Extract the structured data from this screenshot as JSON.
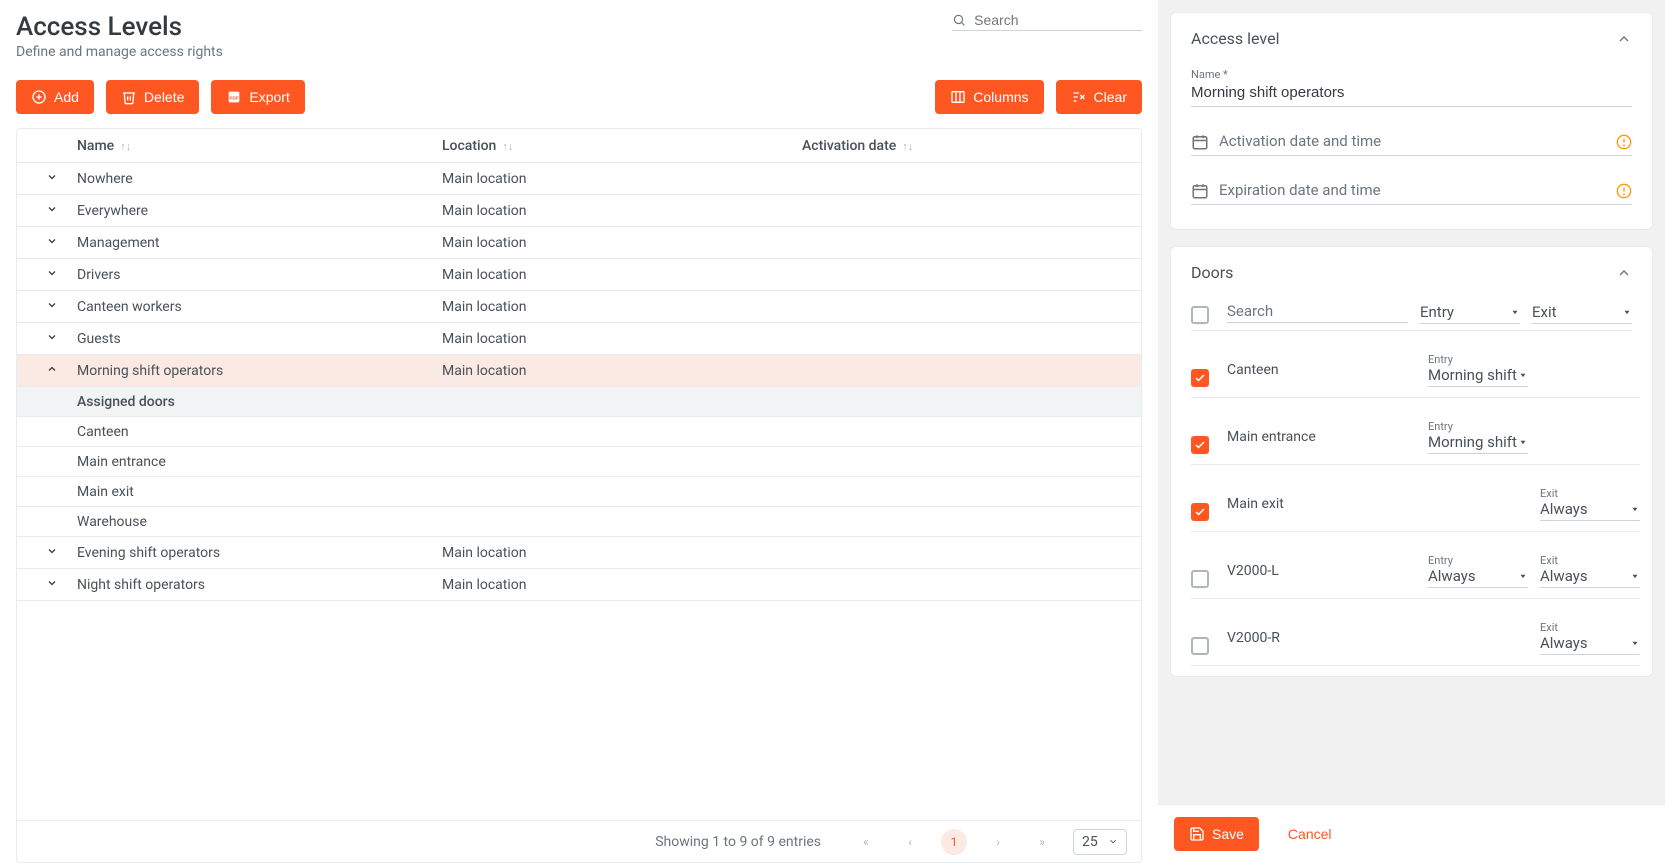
{
  "header": {
    "title": "Access Levels",
    "subtitle": "Define and manage access rights",
    "search_placeholder": "Search"
  },
  "toolbar": {
    "add_label": "Add",
    "delete_label": "Delete",
    "export_label": "Export",
    "columns_label": "Columns",
    "clear_label": "Clear"
  },
  "table": {
    "columns": {
      "name": "Name",
      "location": "Location",
      "activation": "Activation date"
    },
    "rows": [
      {
        "name": "Nowhere",
        "location": "Main location",
        "activation": "",
        "expanded": false,
        "selected": false
      },
      {
        "name": "Everywhere",
        "location": "Main location",
        "activation": "",
        "expanded": false,
        "selected": false
      },
      {
        "name": "Management",
        "location": "Main location",
        "activation": "",
        "expanded": false,
        "selected": false
      },
      {
        "name": "Drivers",
        "location": "Main location",
        "activation": "",
        "expanded": false,
        "selected": false
      },
      {
        "name": "Canteen workers",
        "location": "Main location",
        "activation": "",
        "expanded": false,
        "selected": false
      },
      {
        "name": "Guests",
        "location": "Main location",
        "activation": "",
        "expanded": false,
        "selected": false
      },
      {
        "name": "Morning shift operators",
        "location": "Main location",
        "activation": "",
        "expanded": true,
        "selected": true,
        "detail_header": "Assigned doors",
        "doors": [
          "Canteen",
          "Main entrance",
          "Main exit",
          "Warehouse"
        ]
      },
      {
        "name": "Evening shift operators",
        "location": "Main location",
        "activation": "",
        "expanded": false,
        "selected": false
      },
      {
        "name": "Night shift operators",
        "location": "Main location",
        "activation": "",
        "expanded": false,
        "selected": false
      }
    ],
    "footer": {
      "summary": "Showing 1 to 9 of 9 entries",
      "page": "1",
      "page_size": "25"
    }
  },
  "details": {
    "section_title": "Access level",
    "name_label": "Name *",
    "name_value": "Morning shift operators",
    "activation_placeholder": "Activation date and time",
    "expiration_placeholder": "Expiration date and time"
  },
  "doors_panel": {
    "title": "Doors",
    "search_placeholder": "Search",
    "entry_label": "Entry",
    "exit_label": "Exit",
    "rows": [
      {
        "checked": true,
        "name": "Canteen",
        "entry_label": "Entry",
        "entry_value": "Morning shift",
        "exit_label": null,
        "exit_value": null
      },
      {
        "checked": true,
        "name": "Main entrance",
        "entry_label": "Entry",
        "entry_value": "Morning shift",
        "exit_label": null,
        "exit_value": null
      },
      {
        "checked": true,
        "name": "Main exit",
        "entry_label": null,
        "entry_value": null,
        "exit_label": "Exit",
        "exit_value": "Always"
      },
      {
        "checked": false,
        "name": "V2000-L",
        "entry_label": "Entry",
        "entry_value": "Always",
        "exit_label": "Exit",
        "exit_value": "Always"
      },
      {
        "checked": false,
        "name": "V2000-R",
        "entry_label": null,
        "entry_value": null,
        "exit_label": "Exit",
        "exit_value": "Always"
      }
    ]
  },
  "actions": {
    "save_label": "Save",
    "cancel_label": "Cancel"
  }
}
